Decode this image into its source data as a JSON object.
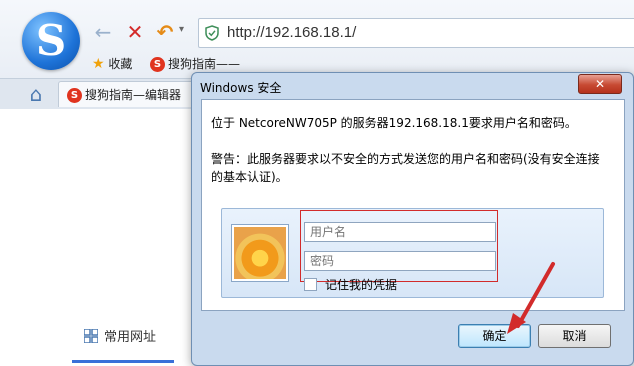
{
  "browser": {
    "address": "http://192.168.18.1/",
    "favorites": {
      "bookmarks_label": "收藏",
      "sogou_link": "搜狗指南——"
    },
    "tabs": [
      {
        "label": "搜狗指南—编辑器"
      }
    ],
    "quick_links_label": "常用网址"
  },
  "dialog": {
    "title": "Windows 安全",
    "message": "位于 NetcoreNW705P 的服务器192.168.18.1要求用户名和密码。",
    "warning": "警告：此服务器要求以不安全的方式发送您的用户名和密码(没有安全连接的基本认证)。",
    "username_placeholder": "用户名",
    "password_placeholder": "密码",
    "remember_label": "记住我的凭据",
    "ok_label": "确定",
    "cancel_label": "取消",
    "close_glyph": "✕"
  },
  "icons": {
    "logo": "sogou-logo",
    "back": "back-arrow-icon",
    "stop": "stop-x-icon",
    "undo": "undo-icon",
    "home": "home-icon",
    "shield": "shield-icon",
    "star": "star-icon",
    "grid": "grid-icon"
  },
  "colors": {
    "annotation_red": "#d22b2b",
    "dialog_frame": "#c9daee",
    "ok_button": "#bee6fd"
  }
}
